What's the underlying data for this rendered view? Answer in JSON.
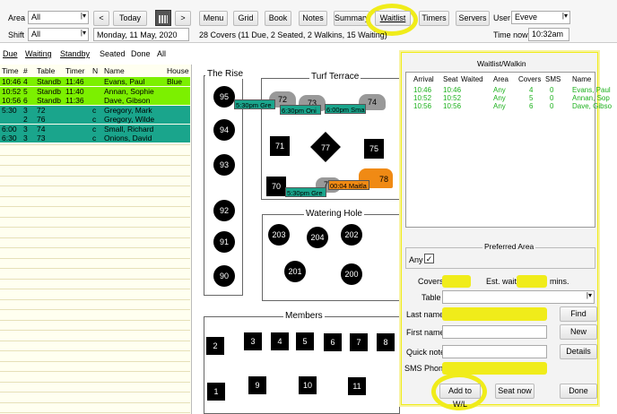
{
  "toolbar": {
    "area_label": "Area",
    "area_value": "All",
    "shift_label": "Shift",
    "shift_value": "All",
    "prev": "<",
    "today": "Today",
    "next": ">",
    "date": "Monday, 11 May, 2020",
    "tabs": [
      "Menu",
      "Grid",
      "Book",
      "Notes",
      "Summary",
      "Waitlist",
      "Timers",
      "Servers"
    ],
    "summary": "28 Covers (11 Due, 2 Seated, 2 Walkins, 15 Waiting)",
    "user_label": "User",
    "user_value": "Eveve",
    "time_now_label": "Time now",
    "time_now_value": "10:32am"
  },
  "filters": [
    "Due",
    "Waiting",
    "Standby",
    "Seated",
    "Done",
    "All"
  ],
  "list": {
    "headers": [
      "Time",
      "#",
      "Table",
      "Timer",
      "N",
      "Name",
      "House"
    ],
    "rows": [
      {
        "time": "10:46",
        "num": "4",
        "table": "Standb",
        "timer": "11:46",
        "n": "",
        "name": "Evans, Paul",
        "house": "Blue",
        "bg": "#7cf000"
      },
      {
        "time": "10:52",
        "num": "5",
        "table": "Standb",
        "timer": "11:40",
        "n": "",
        "name": "Annan, Sophie",
        "house": "",
        "bg": "#7cf000"
      },
      {
        "time": "10:56",
        "num": "6",
        "table": "Standb",
        "timer": "11:36",
        "n": "",
        "name": "Dave, Gibson",
        "house": "",
        "bg": "#7cf000"
      },
      {
        "time": "5:30",
        "num": "3",
        "table": "72",
        "timer": "",
        "n": "c",
        "name": "Gregory, Mark",
        "house": "",
        "bg": "#1aa58c"
      },
      {
        "time": "",
        "num": "2",
        "table": "76",
        "timer": "",
        "n": "c",
        "name": "Gregory, Wilde",
        "house": "",
        "bg": "#1aa58c"
      },
      {
        "time": "6:00",
        "num": "3",
        "table": "74",
        "timer": "",
        "n": "c",
        "name": "Small, Richard",
        "house": "",
        "bg": "#1aa58c"
      },
      {
        "time": "6:30",
        "num": "3",
        "table": "73",
        "timer": "",
        "n": "c",
        "name": "Onions, David",
        "house": "",
        "bg": "#1aa58c"
      }
    ]
  },
  "floor": {
    "the_rise": "The Rise",
    "turf_terrace": "Turf Terrace",
    "watering_hole": "Watering Hole",
    "members": "Members",
    "rise_tables": [
      "95",
      "94",
      "93",
      "92",
      "91",
      "90"
    ],
    "turf_tables": [
      "72",
      "73",
      "74",
      "71",
      "77",
      "75",
      "70",
      "76",
      "78"
    ],
    "water_tables": [
      "203",
      "204",
      "202",
      "201",
      "200"
    ],
    "member_tables": [
      "2",
      "3",
      "4",
      "5",
      "6",
      "7",
      "8",
      "1",
      "9",
      "10",
      "11"
    ],
    "tags": [
      "5:30pm Gre",
      "6:30pm Oni",
      "6:00pm Sma",
      "5:30pm Gre",
      "00:04 Maitla"
    ]
  },
  "waitlist": {
    "title": "Waitlist/Walkin",
    "headers": [
      "Arrival",
      "Seat",
      "Waited",
      "Area",
      "Covers",
      "SMS",
      "Name"
    ],
    "rows": [
      {
        "arrival": "10:46",
        "seat": "10:46",
        "waited": "",
        "area": "Any",
        "covers": "4",
        "sms": "0",
        "name": "Evans, Paul"
      },
      {
        "arrival": "10:52",
        "seat": "10:52",
        "waited": "",
        "area": "Any",
        "covers": "5",
        "sms": "0",
        "name": "Annan, Sop"
      },
      {
        "arrival": "10:56",
        "seat": "10:56",
        "waited": "",
        "area": "Any",
        "covers": "6",
        "sms": "0",
        "name": "Dave, Gibso"
      }
    ],
    "preferred_area": "Preferred Area",
    "any_label": "Any",
    "any_check": "✓",
    "covers_label": "Covers",
    "est_wait_label": "Est. wait",
    "mins_label": "mins.",
    "table_label": "Table",
    "last_name_label": "Last name",
    "first_name_label": "First name",
    "quick_note_label": "Quick note",
    "sms_phone_label": "SMS Phone",
    "find": "Find",
    "new": "New",
    "details": "Details",
    "add_wl": "Add to W/L",
    "seat_now": "Seat now",
    "done": "Done"
  },
  "colors": {
    "highlight": "#f0ec1a",
    "standby_green": "#7cf000",
    "seated_teal": "#1aa58c",
    "waitlist_text": "#1db11d",
    "orange": "#f08a14"
  }
}
